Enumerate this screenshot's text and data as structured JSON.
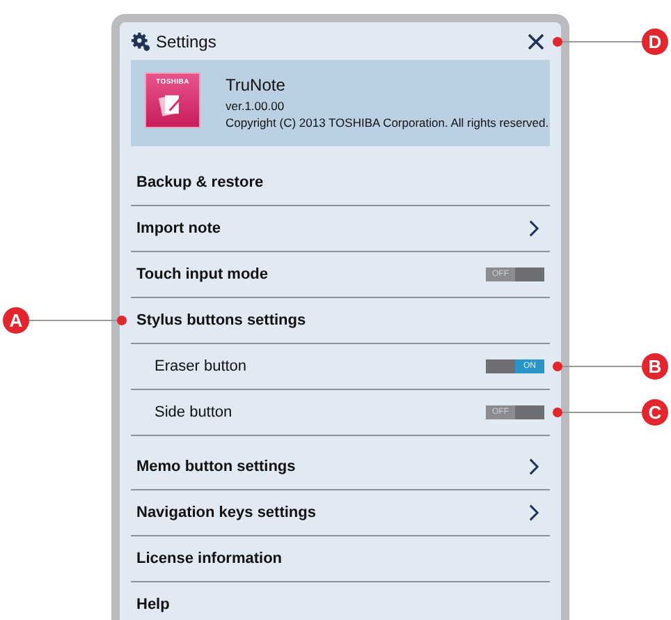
{
  "window": {
    "title": "Settings",
    "callout": "D"
  },
  "app": {
    "icon_text": "TOSHIBA",
    "name": "TruNote",
    "version": "ver.1.00.00",
    "copyright": "Copyright (C) 2013 TOSHIBA Corporation. All rights reserved."
  },
  "items": [
    {
      "label": "Backup & restore",
      "kind": "plain"
    },
    {
      "label": "Import note",
      "kind": "link"
    },
    {
      "label": "Touch input mode",
      "kind": "toggle",
      "on": false,
      "state_label": "OFF"
    },
    {
      "label": "Stylus buttons settings",
      "kind": "plain",
      "callout": "A",
      "children": [
        {
          "label": "Eraser button",
          "kind": "toggle",
          "on": true,
          "state_label": "ON",
          "callout": "B"
        },
        {
          "label": "Side button",
          "kind": "toggle",
          "on": false,
          "state_label": "OFF",
          "callout": "C"
        }
      ]
    },
    {
      "label": "Memo button settings",
      "kind": "link"
    },
    {
      "label": "Navigation keys settings",
      "kind": "link"
    },
    {
      "label": "License information",
      "kind": "plain"
    },
    {
      "label": "Help",
      "kind": "plain"
    }
  ]
}
